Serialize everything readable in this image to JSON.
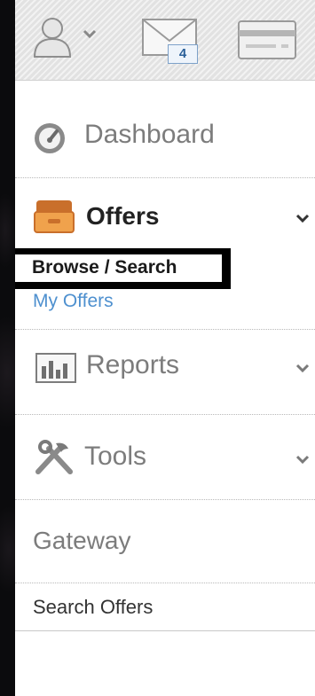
{
  "topbar": {
    "user_icon": "user-icon",
    "mail_icon": "mail-icon",
    "mail_count": "4",
    "card_icon": "credit-card-icon"
  },
  "nav": {
    "dashboard": {
      "label": "Dashboard",
      "icon": "dashboard-gauge-icon"
    },
    "offers": {
      "label": "Offers",
      "icon": "drawer-icon",
      "expanded": true,
      "children": [
        {
          "label": "Browse / Search",
          "active": true
        },
        {
          "label": "My Offers",
          "active": false
        }
      ]
    },
    "reports": {
      "label": "Reports",
      "icon": "bar-chart-icon"
    },
    "tools": {
      "label": "Tools",
      "icon": "tools-icon"
    },
    "gateway": {
      "label": "Gateway"
    },
    "search_offers": {
      "label": "Search Offers"
    }
  },
  "colors": {
    "accent_link": "#4e90cf",
    "muted_text": "#7c7c7c",
    "offers_orange": "#e08a3a"
  }
}
